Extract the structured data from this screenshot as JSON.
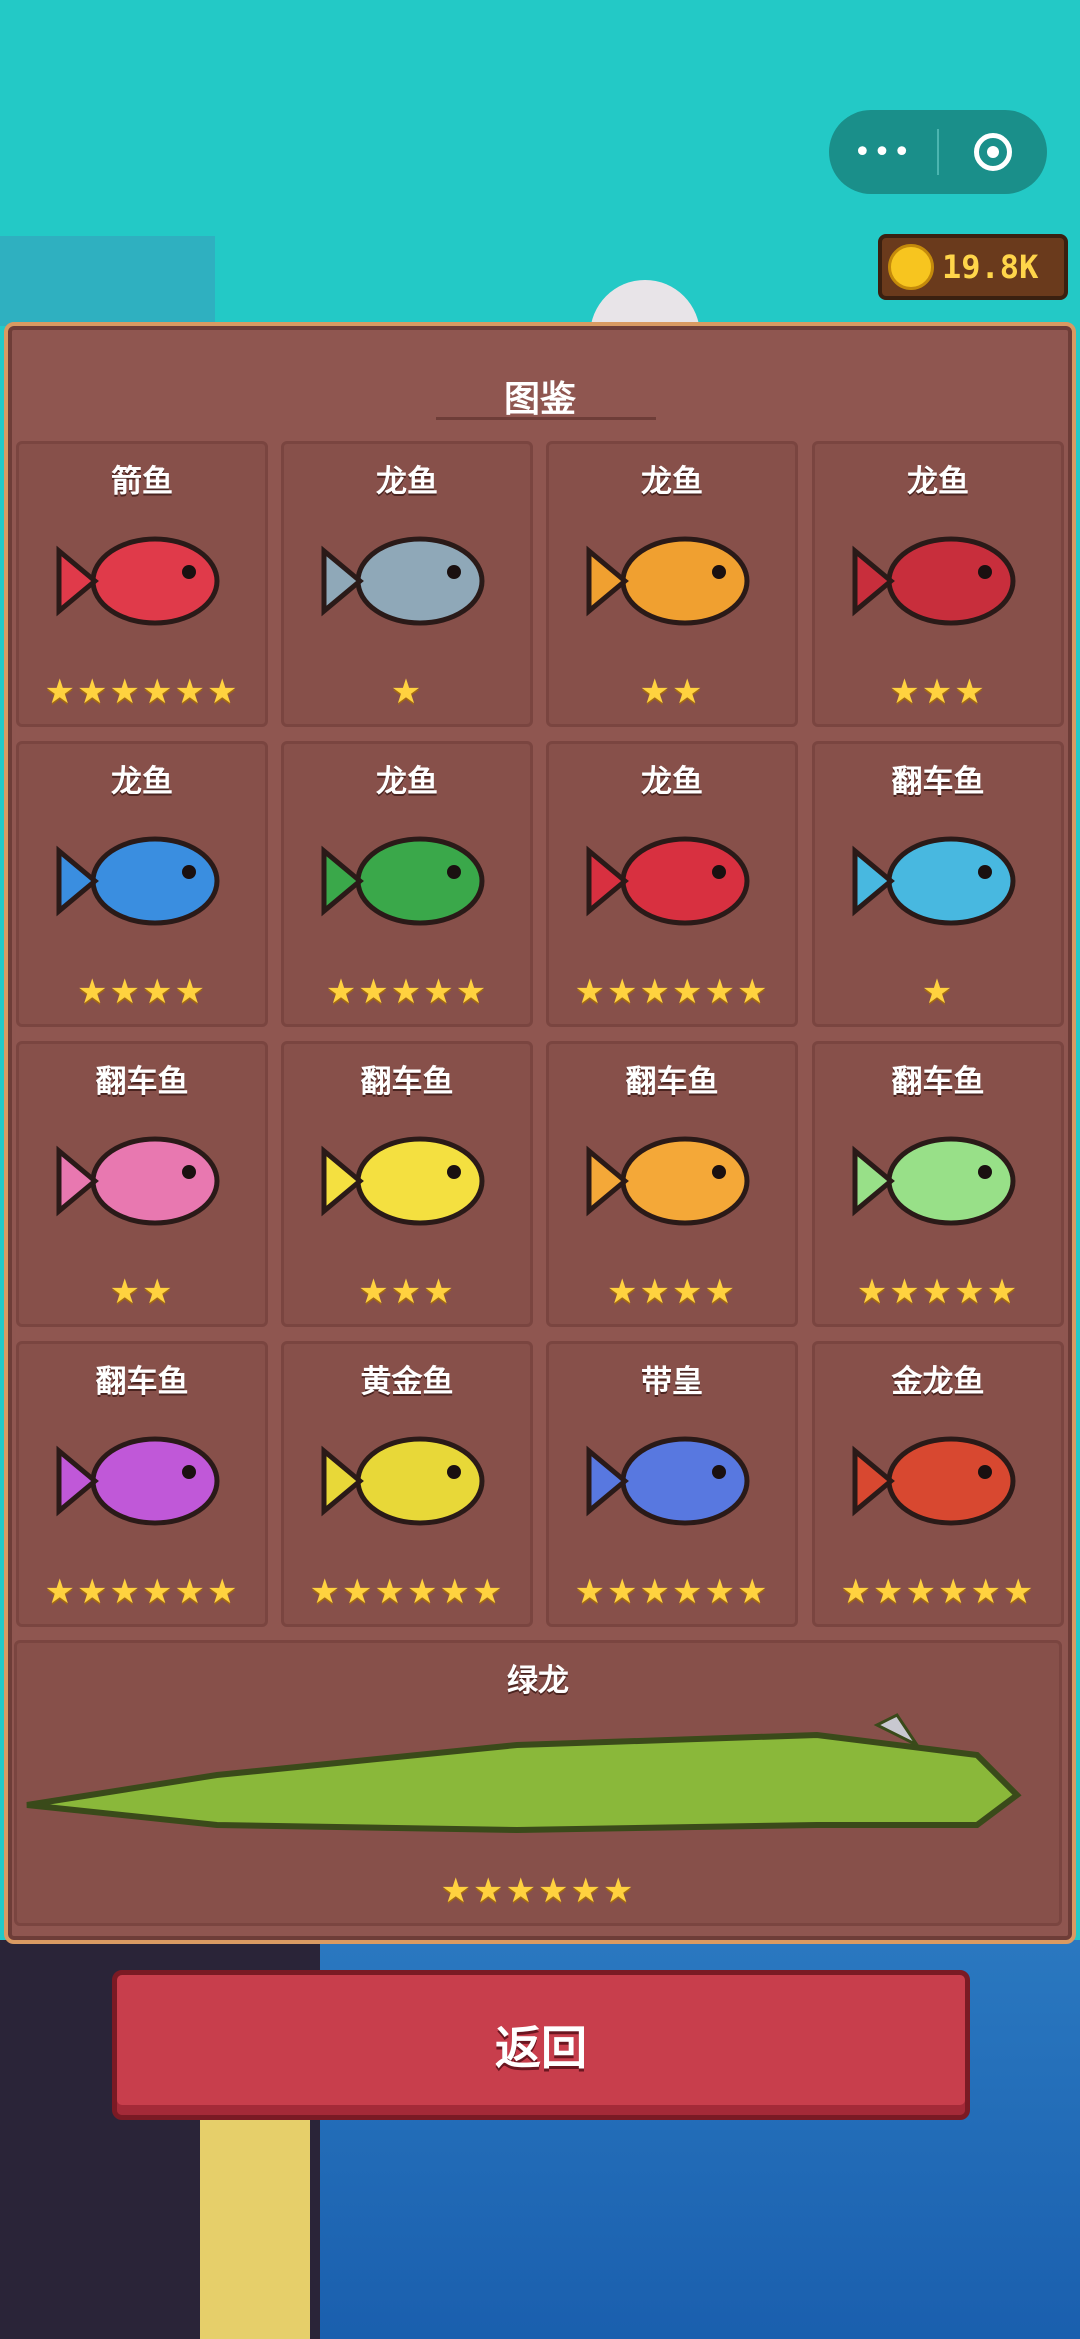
{
  "header": {
    "menu_icon": "more-dots-icon",
    "close_icon": "target-circle-icon"
  },
  "coins": {
    "amount": "19.8K",
    "icon": "gold-coin-icon"
  },
  "panel": {
    "title": "图鉴"
  },
  "cards": [
    {
      "name": "箭鱼",
      "stars": "★★★★★★",
      "color": "#e03a4a"
    },
    {
      "name": "龙鱼",
      "stars": "★",
      "color": "#8fa8b8"
    },
    {
      "name": "龙鱼",
      "stars": "★★",
      "color": "#f0a030"
    },
    {
      "name": "龙鱼",
      "stars": "★★★",
      "color": "#c82e3c"
    },
    {
      "name": "龙鱼",
      "stars": "★★★★",
      "color": "#3a8ee0"
    },
    {
      "name": "龙鱼",
      "stars": "★★★★★",
      "color": "#3aa84a"
    },
    {
      "name": "龙鱼",
      "stars": "★★★★★★",
      "color": "#d83040"
    },
    {
      "name": "翻车鱼",
      "stars": "★",
      "color": "#48b8e0"
    },
    {
      "name": "翻车鱼",
      "stars": "★★",
      "color": "#e878b0"
    },
    {
      "name": "翻车鱼",
      "stars": "★★★",
      "color": "#f4e040"
    },
    {
      "name": "翻车鱼",
      "stars": "★★★★",
      "color": "#f4a838"
    },
    {
      "name": "翻车鱼",
      "stars": "★★★★★",
      "color": "#98e088"
    },
    {
      "name": "翻车鱼",
      "stars": "★★★★★★",
      "color": "#c058d8"
    },
    {
      "name": "黄金鱼",
      "stars": "★★★★★★",
      "color": "#e8d838"
    },
    {
      "name": "带皇",
      "stars": "★★★★★★",
      "color": "#5878e0"
    },
    {
      "name": "金龙鱼",
      "stars": "★★★★★★",
      "color": "#d84830"
    }
  ],
  "wide_card": {
    "name": "绿龙",
    "stars": "★★★★★★",
    "color": "#8ab83a"
  },
  "back_button": {
    "label": "返回"
  }
}
